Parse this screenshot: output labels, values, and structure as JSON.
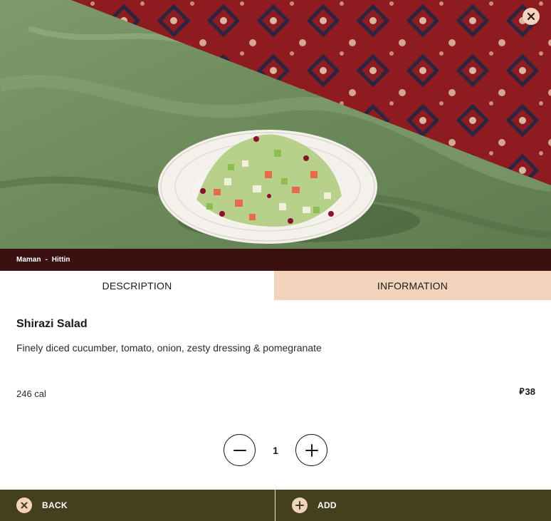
{
  "hero": {
    "image_description_icon": "salad-photo",
    "close_icon": "close-icon"
  },
  "breadcrumb": {
    "brand": "Maman",
    "separator": "-",
    "branch": "Hittin"
  },
  "tabs": [
    {
      "label": "DESCRIPTION",
      "active": true
    },
    {
      "label": "INFORMATION",
      "active": false
    }
  ],
  "item": {
    "name": "Shirazi Salad",
    "description": "Finely diced cucumber, tomato, onion, zesty dressing & pomegranate",
    "calories": "246 cal",
    "currency_symbol": "⃁",
    "price": "38"
  },
  "quantity": {
    "value": "1",
    "minus_icon": "minus-icon",
    "plus_icon": "plus-icon"
  },
  "actions": {
    "back_label": "BACK",
    "add_label": "ADD"
  },
  "colors": {
    "strip_bg": "#3b1010",
    "tab_inactive_bg": "#f3d3bb",
    "bottom_bar_bg": "#44401e",
    "icon_bg": "#f3d3bb"
  }
}
